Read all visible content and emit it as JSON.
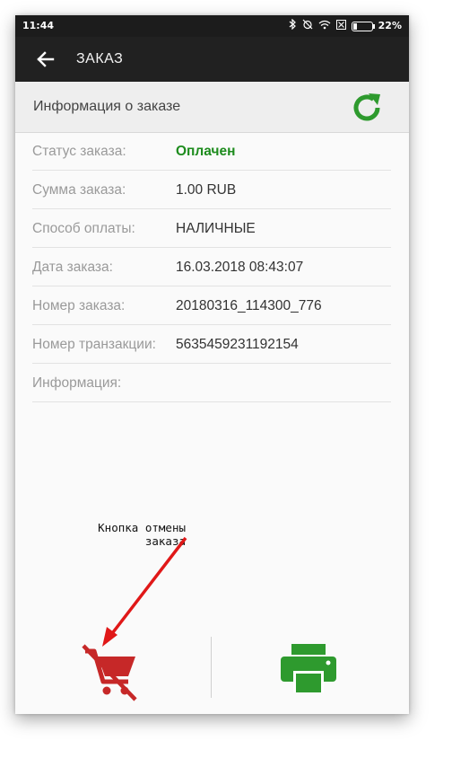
{
  "status_bar": {
    "time": "11:44",
    "battery": "22%",
    "battery_level": 0.22,
    "icons": [
      "bluetooth-icon",
      "alarm-off-icon",
      "wifi-icon",
      "sim-off-icon",
      "battery-icon"
    ]
  },
  "app_bar": {
    "title": "ЗАКАЗ",
    "back_icon": "arrow-left-icon"
  },
  "section": {
    "title": "Информация о заказе",
    "refresh_icon": "refresh-icon",
    "accent": "#2e9a2e"
  },
  "order_fields": [
    {
      "label": "Статус заказа:",
      "value": "Оплачен"
    },
    {
      "label": "Сумма заказа:",
      "value": "1.00 RUB"
    },
    {
      "label": "Способ оплаты:",
      "value": "НАЛИЧНЫЕ"
    },
    {
      "label": "Дата заказа:",
      "value": "16.03.2018 08:43:07"
    },
    {
      "label": "Номер заказа:",
      "value": "20180316_114300_776"
    },
    {
      "label": "Номер транзакции:",
      "value": "5635459231192154"
    },
    {
      "label": "Информация:",
      "value": ""
    }
  ],
  "annotation": {
    "line1": "Кнопка отмены",
    "line2": "заказа"
  },
  "actions": {
    "cancel_icon": "cart-cancel-icon",
    "cancel_color": "#c62828",
    "print_icon": "printer-icon",
    "print_color": "#2e9a2e"
  }
}
